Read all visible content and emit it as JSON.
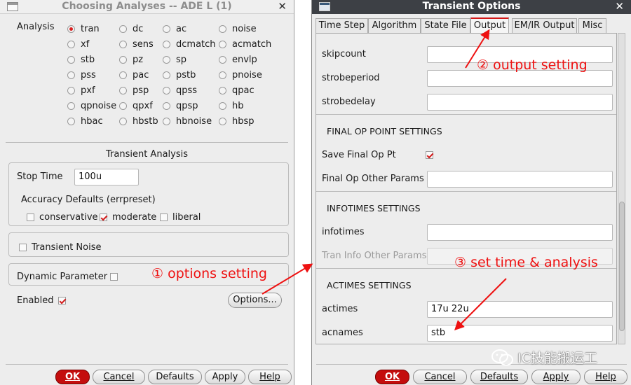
{
  "left_window": {
    "title": "Choosing Analyses -- ADE L (1)",
    "analysis_label": "Analysis",
    "analyses": [
      {
        "label": "tran",
        "selected": true
      },
      {
        "label": "dc",
        "selected": false
      },
      {
        "label": "ac",
        "selected": false
      },
      {
        "label": "noise",
        "selected": false
      },
      {
        "label": "xf",
        "selected": false
      },
      {
        "label": "sens",
        "selected": false
      },
      {
        "label": "dcmatch",
        "selected": false
      },
      {
        "label": "acmatch",
        "selected": false
      },
      {
        "label": "stb",
        "selected": false
      },
      {
        "label": "pz",
        "selected": false
      },
      {
        "label": "sp",
        "selected": false
      },
      {
        "label": "envlp",
        "selected": false
      },
      {
        "label": "pss",
        "selected": false
      },
      {
        "label": "pac",
        "selected": false
      },
      {
        "label": "pstb",
        "selected": false
      },
      {
        "label": "pnoise",
        "selected": false
      },
      {
        "label": "pxf",
        "selected": false
      },
      {
        "label": "psp",
        "selected": false
      },
      {
        "label": "qpss",
        "selected": false
      },
      {
        "label": "qpac",
        "selected": false
      },
      {
        "label": "qpnoise",
        "selected": false
      },
      {
        "label": "qpxf",
        "selected": false
      },
      {
        "label": "qpsp",
        "selected": false
      },
      {
        "label": "hb",
        "selected": false
      },
      {
        "label": "hbac",
        "selected": false
      },
      {
        "label": "hbstb",
        "selected": false
      },
      {
        "label": "hbnoise",
        "selected": false
      },
      {
        "label": "hbsp",
        "selected": false
      }
    ],
    "section_title": "Transient Analysis",
    "stop_time_label": "Stop Time",
    "stop_time_value": "100u",
    "accuracy_label": "Accuracy Defaults (errpreset)",
    "accuracy": [
      {
        "label": "conservative",
        "checked": false
      },
      {
        "label": "moderate",
        "checked": true
      },
      {
        "label": "liberal",
        "checked": false
      }
    ],
    "transient_noise_label": "Transient Noise",
    "transient_noise_checked": false,
    "dynamic_param_label": "Dynamic Parameter",
    "dynamic_param_checked": false,
    "enabled_label": "Enabled",
    "enabled_checked": true,
    "options_button": "Options...",
    "buttons": {
      "ok": "OK",
      "cancel": "Cancel",
      "defaults": "Defaults",
      "apply": "Apply",
      "help": "Help"
    }
  },
  "right_window": {
    "title": "Transient Options",
    "tabs": [
      {
        "label": "Time Step",
        "active": false
      },
      {
        "label": "Algorithm",
        "active": false
      },
      {
        "label": "State File",
        "active": false
      },
      {
        "label": "Output",
        "active": true
      },
      {
        "label": "EM/IR Output",
        "active": false
      },
      {
        "label": "Misc",
        "active": false
      }
    ],
    "rows": {
      "skipcount": {
        "label": "skipcount",
        "value": ""
      },
      "strobeperiod": {
        "label": "strobeperiod",
        "value": ""
      },
      "strobedelay": {
        "label": "strobedelay",
        "value": ""
      },
      "final_op_header": "FINAL OP POINT SETTINGS",
      "save_final_op": {
        "label": "Save Final Op Pt",
        "checked": true
      },
      "final_op_other": {
        "label": "Final Op Other Params",
        "value": ""
      },
      "infotimes_header": "INFOTIMES SETTINGS",
      "infotimes": {
        "label": "infotimes",
        "value": ""
      },
      "tran_info_other": {
        "label": "Tran Info Other Params",
        "value": ""
      },
      "actimes_header": "ACTIMES SETTINGS",
      "actimes": {
        "label": "actimes",
        "value": "17u 22u"
      },
      "acnames": {
        "label": "acnames",
        "value": "stb"
      }
    },
    "buttons": {
      "ok": "OK",
      "cancel": "Cancel",
      "defaults": "Defaults",
      "apply": "Apply",
      "help": "Help"
    }
  },
  "annotations": {
    "options_setting": "① options setting",
    "output_setting": "② output setting",
    "time_analysis": "③ set time & analysis",
    "arrow_color": "#ee1111"
  },
  "watermark": "IC技能搬运工"
}
